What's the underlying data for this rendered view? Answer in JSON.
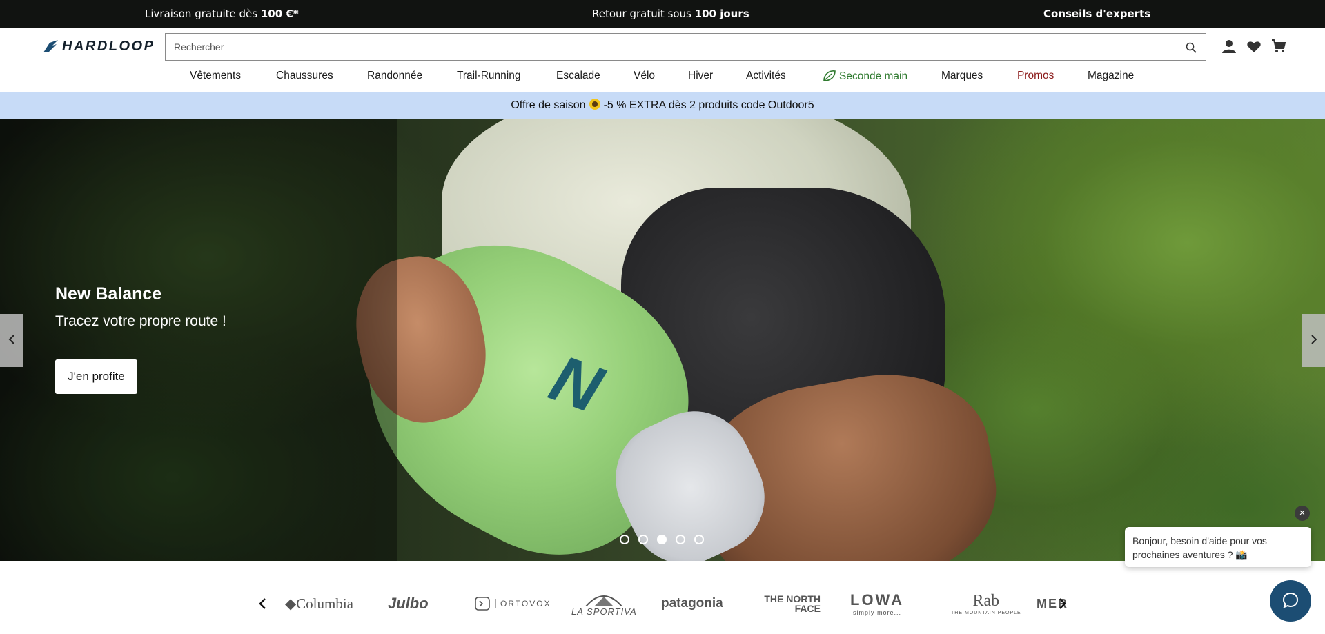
{
  "topbar": {
    "shipping_prefix": "Livraison gratuite dès",
    "shipping_amount": "100 €*",
    "returns_prefix": "Retour gratuit sous",
    "returns_days": "100 jours",
    "experts": "Conseils d'experts"
  },
  "header": {
    "logo_text": "HARDLOOP",
    "search_placeholder": "Rechercher",
    "icons": [
      "account-icon",
      "heart-icon",
      "cart-icon"
    ]
  },
  "nav": {
    "items": [
      {
        "label": "Vêtements"
      },
      {
        "label": "Chaussures"
      },
      {
        "label": "Randonnée"
      },
      {
        "label": "Trail-Running"
      },
      {
        "label": "Escalade"
      },
      {
        "label": "Vélo"
      },
      {
        "label": "Hiver"
      },
      {
        "label": "Activités"
      },
      {
        "label": "Seconde main"
      },
      {
        "label": "Marques"
      },
      {
        "label": "Promos"
      },
      {
        "label": "Magazine"
      }
    ],
    "seconde_main_color": "#2f7a2f",
    "promos_color": "#8b1a1a"
  },
  "promo": {
    "prefix": "Offre de saison",
    "suffix": "-5 % EXTRA dès 2 produits code Outdoor5",
    "background": "#c7dbf7"
  },
  "hero": {
    "title": "New Balance",
    "subtitle": "Tracez votre propre route !",
    "cta": "J'en profite",
    "slides_count": 5,
    "active_slide": 3
  },
  "brands": [
    "Columbia",
    "Julbo",
    "ORTOVOX",
    "LA SPORTIVA",
    "patagonia",
    "THE NORTH FACE",
    "LOWA",
    "Rab",
    "MER"
  ],
  "brand_taglines": {
    "lowa": "simply more...",
    "rab": "THE MOUNTAIN PEOPLE"
  },
  "chat": {
    "message": "Bonjour, besoin d'aide pour vos prochaines aventures ? 📸",
    "button_color": "#1c4d73"
  }
}
